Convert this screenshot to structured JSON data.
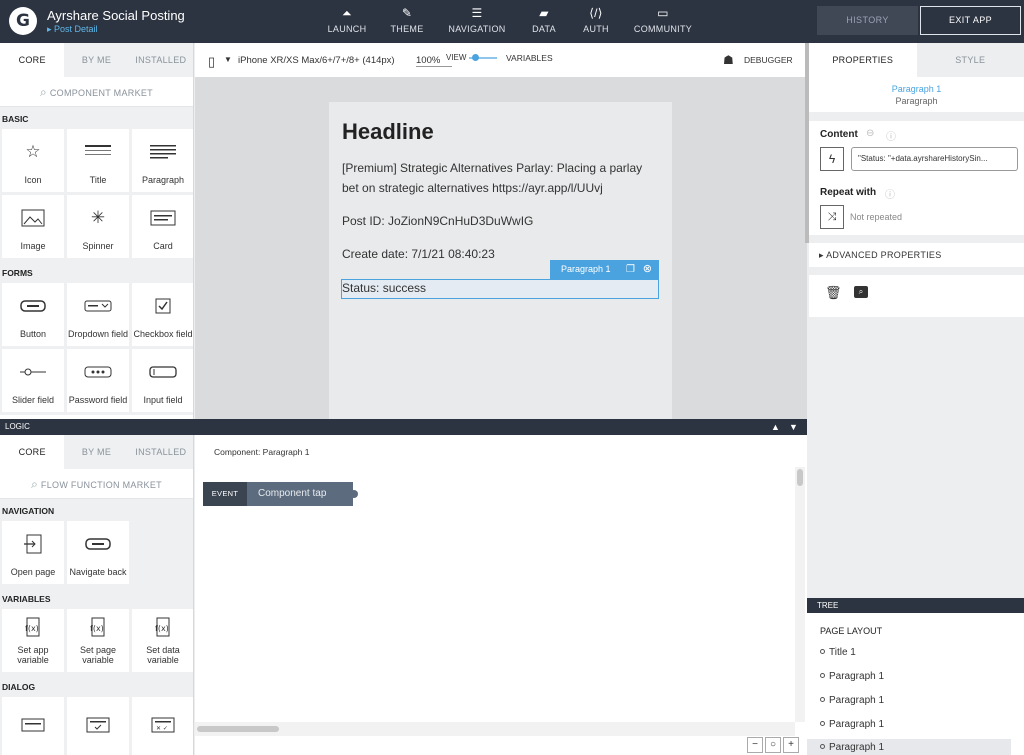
{
  "app": {
    "title": "Ayrshare Social Posting",
    "breadcrumb": "Post Detail",
    "logo_letter": "G"
  },
  "topnav": [
    {
      "label": "LAUNCH",
      "icon": "⏶"
    },
    {
      "label": "THEME",
      "icon": "✎"
    },
    {
      "label": "NAVIGATION",
      "icon": "☰"
    },
    {
      "label": "DATA",
      "icon": "▰"
    },
    {
      "label": "AUTH",
      "icon": "⟨/⟩"
    },
    {
      "label": "COMMUNITY",
      "icon": "▭"
    }
  ],
  "top_buttons": {
    "history": "HISTORY",
    "exit": "EXIT APP"
  },
  "left_tabs": [
    "CORE",
    "BY ME",
    "INSTALLED"
  ],
  "component_market": "COMPONENT MARKET",
  "sections": {
    "basic": "BASIC",
    "forms": "FORMS"
  },
  "basic_tiles": [
    "Icon",
    "Title",
    "Paragraph",
    "Image",
    "Spinner",
    "Card"
  ],
  "form_tiles": [
    "Button",
    "Dropdown field",
    "Checkbox field",
    "Slider field",
    "Password field",
    "Input field"
  ],
  "canvasbar": {
    "device": "iPhone XR/XS Max/6+/7+/8+ (414px)",
    "zoom": "100%",
    "view": "VIEW",
    "variables": "VARIABLES",
    "debugger": "DEBUGGER"
  },
  "page": {
    "headline": "Headline",
    "premium": "[Premium] Strategic Alternatives Parlay: Placing a parlay bet on strategic alternatives https://ayr.app/l/UUvj",
    "post_id": "Post ID: JoZionN9CnHuD3DuWwIG",
    "create_date": "Create date: 7/1/21 08:40:23",
    "status": "Status: success",
    "selected_badge": "Paragraph 1"
  },
  "logic": {
    "bar": "LOGIC",
    "tabs": [
      "CORE",
      "BY ME",
      "INSTALLED"
    ],
    "market": "FLOW FUNCTION MARKET",
    "navigation": "NAVIGATION",
    "nav_tiles": [
      "Open page",
      "Navigate back"
    ],
    "variables": "VARIABLES",
    "var_tiles": [
      "Set app variable",
      "Set page variable",
      "Set data variable"
    ],
    "dialog": "DIALOG",
    "component_label": "Component: Paragraph 1",
    "event_tag": "EVENT",
    "event_name": "Component tap"
  },
  "right": {
    "tabs": [
      "PROPERTIES",
      "STYLE"
    ],
    "selected_name": "Paragraph 1",
    "selected_type": "Paragraph",
    "content_label": "Content",
    "content_value": "\"Status: \"+data.ayrshareHistorySin...",
    "repeat_label": "Repeat with",
    "repeat_value": "Not repeated",
    "advanced": "ADVANCED PROPERTIES"
  },
  "tree": {
    "header": "TREE",
    "root": "PAGE LAYOUT",
    "items": [
      "Title 1",
      "Paragraph 1",
      "Paragraph 1",
      "Paragraph 1",
      "Paragraph 1"
    ]
  },
  "zoom_controls": [
    "−",
    "○",
    "+"
  ]
}
